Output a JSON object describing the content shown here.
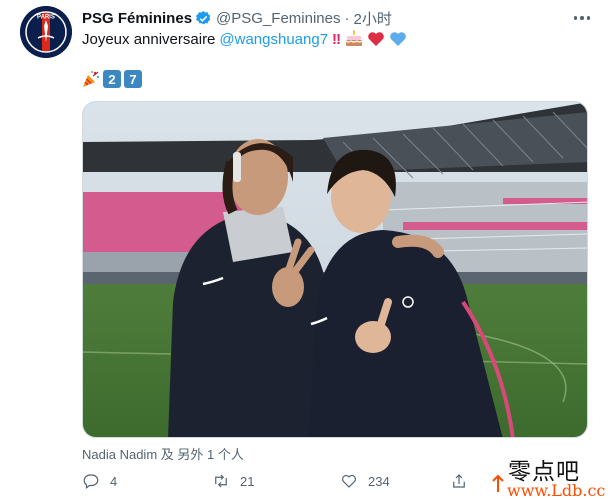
{
  "tweet": {
    "display_name": "PSG Féminines",
    "handle": "@PSG_Feminines",
    "separator": "·",
    "time": "2小时",
    "text_prefix": "Joyeux anniversaire",
    "mention": "@wangshuang7",
    "exclaim": "‼",
    "emoji": [
      "party-popper",
      "birthday-cake",
      "red-heart",
      "blue-heart"
    ],
    "number_keycaps": [
      "2",
      "7"
    ],
    "tagged": "Nadia Nadim 及 另外 1 个人",
    "stats": {
      "replies": "4",
      "retweets": "21",
      "likes": "234"
    }
  },
  "avatar": {
    "logo_text": "PARIS"
  },
  "colors": {
    "accent": "#1d9bf0",
    "muted": "#536471",
    "keycap": "#3b88c3",
    "heart": "#e0245e",
    "avatar_bg": "#0b1f4d"
  },
  "watermark": {
    "title": "零点吧",
    "url": "www.Ldb.cc"
  }
}
